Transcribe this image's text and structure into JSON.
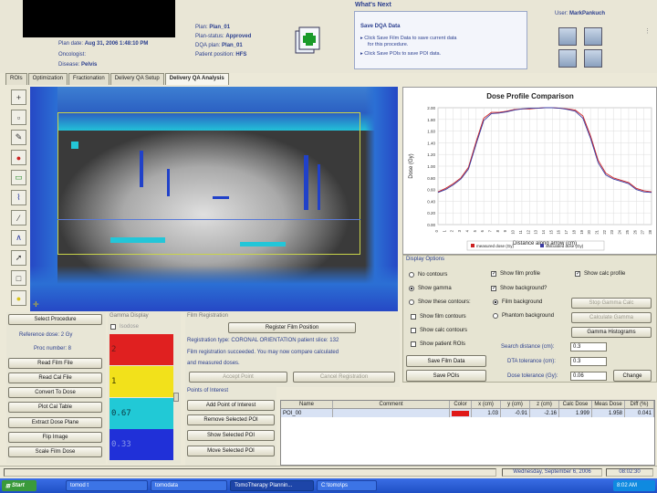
{
  "header": {
    "left_fields": [
      {
        "label": "Plan date:",
        "value": "Aug 31, 2006 1:48:10 PM"
      },
      {
        "label": "Oncologist:",
        "value": ""
      },
      {
        "label": "Disease:",
        "value": "Pelvis"
      }
    ],
    "right_fields": [
      {
        "label": "Plan:",
        "value": "Plan_01"
      },
      {
        "label": "Plan-status:",
        "value": "Approved"
      },
      {
        "label": "DQA plan:",
        "value": "Plan_01"
      },
      {
        "label": "Patient position:",
        "value": "HFS"
      }
    ],
    "whats_next": {
      "title": "What's Next",
      "heading": "Save DQA Data",
      "lines": [
        "Click Save Film Data to save current data",
        "for this procedure.",
        "Click Save POIs to save POI data."
      ]
    },
    "user": {
      "label": "User:",
      "value": "MarkPankuch"
    }
  },
  "tabs": [
    "ROIs",
    "Optimization",
    "Fractionation",
    "Delivery QA Setup",
    "Delivery QA Analysis"
  ],
  "active_tab": 4,
  "toolbar_icons": [
    "crosshair-icon",
    "square-select-icon",
    "pencil-icon",
    "target-icon",
    "folder-icon",
    "roi-icon",
    "profile-line-icon",
    "profile-icon",
    "cursor-icon",
    "square-icon",
    "lightbulb-icon"
  ],
  "chart_data": {
    "type": "line",
    "title": "Dose Profile Comparison",
    "xlabel": "Distance along arrow (cm)",
    "ylabel": "Dose (Gy)",
    "xlim": [
      0,
      28
    ],
    "ylim": [
      0.0,
      2.0
    ],
    "x_ticks": [
      "0",
      "1",
      "2",
      "3",
      "4",
      "5",
      "6",
      "7",
      "8",
      "9",
      "10",
      "11",
      "12",
      "13",
      "14",
      "15",
      "16",
      "17",
      "18",
      "19",
      "20",
      "21",
      "22",
      "23",
      "24",
      "25",
      "26",
      "27",
      "28"
    ],
    "y_ticks": [
      "0.00",
      "0.20",
      "0.40",
      "0.60",
      "0.80",
      "1.00",
      "1.20",
      "1.40",
      "1.60",
      "1.80",
      "2.00"
    ],
    "legend": "bottom",
    "series": [
      {
        "name": "measured dose (Gy)",
        "color": "#cc2222",
        "x": [
          0,
          1,
          2,
          3,
          4,
          5,
          6,
          7,
          8,
          9,
          10,
          11,
          12,
          13,
          14,
          15,
          16,
          17,
          18,
          19,
          20,
          21,
          22,
          23,
          24,
          25,
          26,
          27,
          28
        ],
        "y": [
          0.56,
          0.62,
          0.7,
          0.8,
          0.98,
          1.42,
          1.82,
          1.92,
          1.92,
          1.94,
          1.97,
          1.98,
          1.98,
          1.99,
          2.0,
          2.0,
          1.99,
          1.98,
          1.96,
          1.86,
          1.52,
          1.1,
          0.88,
          0.8,
          0.76,
          0.72,
          0.62,
          0.58,
          0.56
        ]
      },
      {
        "name": "calculated dose (Gy)",
        "color": "#3a3aa0",
        "x": [
          0,
          1,
          2,
          3,
          4,
          5,
          6,
          7,
          8,
          9,
          10,
          11,
          12,
          13,
          14,
          15,
          16,
          17,
          18,
          19,
          20,
          21,
          22,
          23,
          24,
          25,
          26,
          27,
          28
        ],
        "y": [
          0.55,
          0.6,
          0.68,
          0.78,
          0.95,
          1.38,
          1.78,
          1.9,
          1.91,
          1.93,
          1.96,
          1.98,
          1.99,
          1.99,
          2.0,
          2.0,
          1.99,
          1.97,
          1.94,
          1.82,
          1.48,
          1.06,
          0.85,
          0.78,
          0.74,
          0.7,
          0.6,
          0.56,
          0.55
        ]
      }
    ]
  },
  "display_options": {
    "title": "Display Options",
    "radios_left": [
      {
        "label": "No contours",
        "checked": false
      },
      {
        "label": "Show gamma",
        "checked": true
      },
      {
        "label": "Show these contours:",
        "checked": false
      }
    ],
    "checks_left": [
      {
        "label": "Show film contours",
        "checked": false
      },
      {
        "label": "Show calc contours",
        "checked": false
      },
      {
        "label": "Show patient ROIs",
        "checked": false
      }
    ],
    "show_film_profile": "Show film profile",
    "show_calc_profile": "Show calc profile",
    "show_background": "Show background?",
    "film_background": "Film background",
    "phantom_background": "Phantom background",
    "stop_gamma_calc": "Stop Gamma Calc",
    "calculate_gamma": "Calculate Gamma",
    "gamma_histograms": "Gamma Histograms",
    "search_distance_label": "Search distance (cm):",
    "search_distance_value": "0.3",
    "dta_label": "DTA tolerance (cm):",
    "dta_value": "0.3",
    "dose_tol_label": "Dose tolerance (Gy):",
    "dose_tol_value": "0.06",
    "save_film_data": "Save Film Data",
    "save_pois": "Save POIs",
    "change": "Change"
  },
  "procedure": {
    "select": "Select Procedure",
    "reference_dose": "Reference dose:  2 Gy",
    "proc_number": "Proc number: 8",
    "buttons": [
      "Read Film File",
      "Read Cal File",
      "Convert To Dose",
      "Plot Cal Table",
      "Extract Dose Plane",
      "Flip Image",
      "Scale Film Dose"
    ]
  },
  "gamma_display": {
    "title": "Gamma Display",
    "isodose": "Isodose",
    "bars": [
      {
        "label": "2",
        "color": "#e02020",
        "text_color": "#6a1a1a"
      },
      {
        "label": "1",
        "color": "#f2e11b",
        "text_color": "#3a3a00"
      },
      {
        "label": "0.67",
        "color": "#21c9d6",
        "text_color": "#0a3a44"
      },
      {
        "label": "0.33",
        "color": "#2030d8",
        "text_color": "#8a9ae8"
      }
    ]
  },
  "film_registration": {
    "title": "Film Registration",
    "register_button": "Register Film Position",
    "lines": [
      "Registration type: CORONAL ORIENTATION patient slice: 132",
      "Film registration succeeded. You may now compare calculated",
      "and measured doses."
    ],
    "accept_point": "Accept Point",
    "cancel_registration": "Cancel Registration"
  },
  "poi": {
    "title": "Points of Interest",
    "buttons": [
      "Add Point of Interest",
      "Remove Selected POI",
      "Show Selected POI",
      "Move Selected POI"
    ],
    "columns": [
      "Name",
      "Comment",
      "Color",
      "x (cm)",
      "y (cm)",
      "z (cm)",
      "Calc Dose",
      "Meas Dose",
      "Diff (%)"
    ],
    "rows": [
      {
        "name": "POI_00",
        "comment": "",
        "color": "#e01818",
        "x": "1.03",
        "y": "-0.91",
        "z": "-2.16",
        "calc": "1.999",
        "meas": "1.958",
        "diff": "0.041"
      }
    ]
  },
  "status": {
    "date": "Wednesday, September 6, 2006",
    "time": "08:02:30"
  },
  "taskbar": {
    "start": "Start",
    "tasks": [
      "tomod t",
      "tomodata",
      "TomoTherapy Plannin...",
      "C:\\tomo\\ps"
    ],
    "clock": "8:02 AM"
  }
}
